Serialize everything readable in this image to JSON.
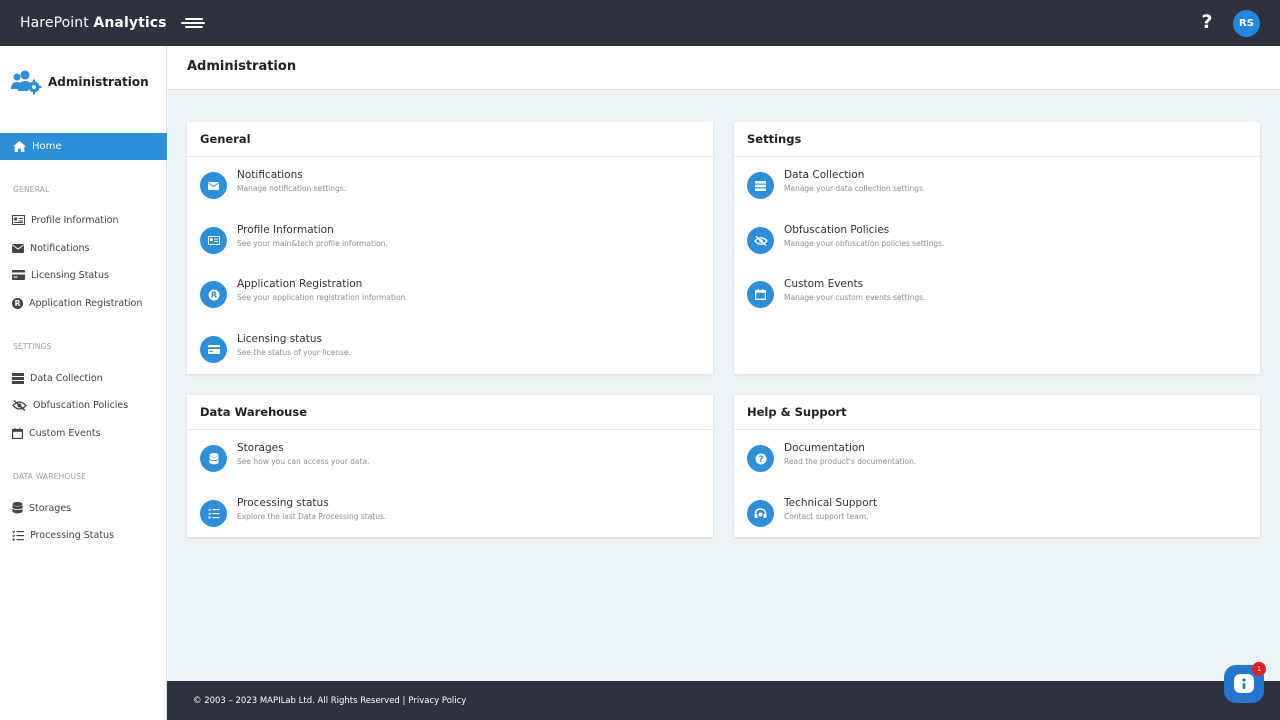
{
  "topbar": {
    "brand_light": "HarePoint ",
    "brand_bold": "Analytics",
    "help": "?",
    "avatar_initials": "RS"
  },
  "sidebar": {
    "title": "Administration",
    "home": "Home",
    "sections": {
      "general": "GENERAL",
      "settings": "SETTINGS",
      "data_warehouse": "DATA WAREHOUSE"
    },
    "general_items": [
      "Profile Information",
      "Notifications",
      "Licensing Status",
      "Application Registration"
    ],
    "settings_items": [
      "Data Collection",
      "Obfuscation Policies",
      "Custom Events"
    ],
    "warehouse_items": [
      "Storages",
      "Processing Status"
    ]
  },
  "page": {
    "title": "Administration"
  },
  "cards": {
    "general": {
      "title": "General",
      "entries": [
        {
          "title": "Notifications",
          "desc": "Manage notification settings.",
          "icon": "envelope-icon"
        },
        {
          "title": "Profile Information",
          "desc": "See your main&tech profile information.",
          "icon": "id-card-icon"
        },
        {
          "title": "Application Registration",
          "desc": "See your application registration information.",
          "icon": "registered-icon"
        },
        {
          "title": "Licensing status",
          "desc": "See the status of your license.",
          "icon": "credit-card-icon"
        }
      ]
    },
    "settings": {
      "title": "Settings",
      "entries": [
        {
          "title": "Data Collection",
          "desc": "Manage your data collection settings.",
          "icon": "server-icon"
        },
        {
          "title": "Obfuscation Policies",
          "desc": "Manage your obfuscation policies settings.",
          "icon": "eye-slash-icon"
        },
        {
          "title": "Custom Events",
          "desc": "Manage your custom events settings.",
          "icon": "calendar-icon"
        }
      ]
    },
    "warehouse": {
      "title": "Data Warehouse",
      "entries": [
        {
          "title": "Storages",
          "desc": "See how you can access your data.",
          "icon": "database-icon"
        },
        {
          "title": "Processing status",
          "desc": "Explore the last Data Processing status.",
          "icon": "tasks-icon"
        }
      ]
    },
    "support": {
      "title": "Help & Support",
      "entries": [
        {
          "title": "Documentation",
          "desc": "Read the product's documentation.",
          "icon": "question-circle-icon"
        },
        {
          "title": "Technical Support",
          "desc": "Contact support team.",
          "icon": "headset-icon"
        }
      ]
    }
  },
  "footer": {
    "copyright": "© 2003 – 2023 MAPILab Ltd. All Rights Reserved |",
    "privacy": "Privacy Policy"
  },
  "chat": {
    "badge": "1"
  },
  "colors": {
    "accent": "#2b8fdc",
    "topbar": "#2d323e",
    "background": "#edf4f8"
  }
}
